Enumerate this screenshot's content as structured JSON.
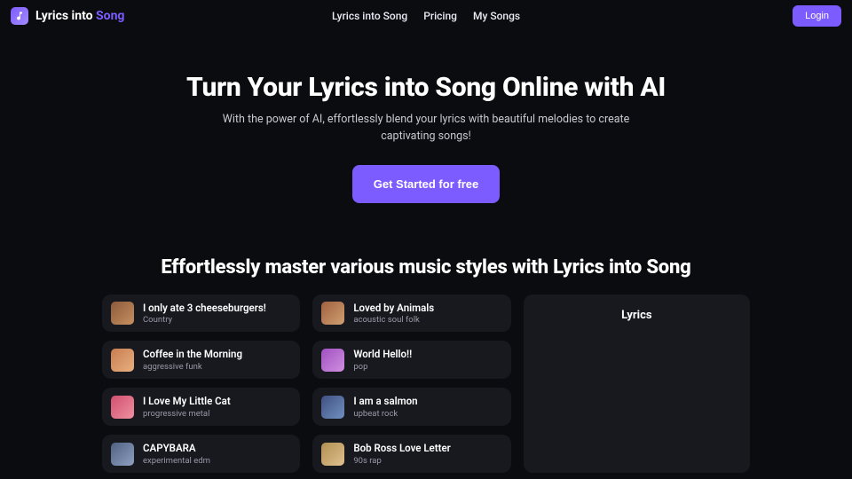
{
  "brand": {
    "prefix": "Lyrics into ",
    "accent": "Song"
  },
  "nav": {
    "items": [
      {
        "label": "Lyrics into Song"
      },
      {
        "label": "Pricing"
      },
      {
        "label": "My Songs"
      }
    ],
    "login": "Login"
  },
  "hero": {
    "title": "Turn Your Lyrics into Song Online with AI",
    "subtitle": "With the power of AI, effortlessly blend your lyrics with beautiful melodies to create captivating songs!",
    "cta": "Get Started for free"
  },
  "section": {
    "title": "Effortlessly master various music styles with Lyrics into Song"
  },
  "songs_left": [
    {
      "title": "I only ate 3 cheeseburgers!",
      "style": "Country"
    },
    {
      "title": "Coffee in the Morning",
      "style": "aggressive funk"
    },
    {
      "title": "I Love My Little Cat",
      "style": "progressive metal"
    },
    {
      "title": " CAPYBARA",
      "style": "experimental edm"
    }
  ],
  "songs_right": [
    {
      "title": "Loved by Animals",
      "style": "acoustic soul folk"
    },
    {
      "title": "World Hello!!",
      "style": "pop"
    },
    {
      "title": "I am a salmon",
      "style": "upbeat rock"
    },
    {
      "title": "Bob Ross Love Letter",
      "style": "90s rap"
    }
  ],
  "lyrics_panel": {
    "heading": "Lyrics"
  }
}
